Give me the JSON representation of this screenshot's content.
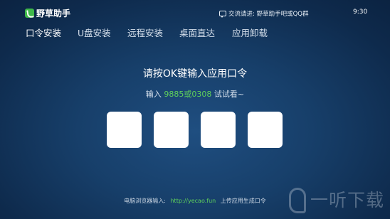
{
  "app": {
    "name": "野草助手"
  },
  "header": {
    "contact_text": "交流请进: 野草助手吧或QQ群",
    "contact_icon": "chat-bubble-icon",
    "qq_icon": "qq-penguin-icon",
    "time": "9:30"
  },
  "tabs": [
    {
      "label": "口令安装",
      "active": true
    },
    {
      "label": "U盘安装",
      "active": false
    },
    {
      "label": "远程安装",
      "active": false
    },
    {
      "label": "桌面直达",
      "active": false
    },
    {
      "label": "应用卸载",
      "active": false
    }
  ],
  "main": {
    "heading": "请按OK键输入应用口令",
    "hint_prefix": "输入",
    "hint_code": "9885或0308",
    "hint_suffix": "试试看~",
    "code_boxes": [
      "",
      "",
      "",
      ""
    ]
  },
  "footer": {
    "prefix": "电脑浏览器输入:",
    "url": "http://yecao.fun",
    "suffix": "上传应用生成口令"
  },
  "watermark": {
    "text": "一听下载"
  },
  "colors": {
    "accent_green": "#5fd15b",
    "logo_green": "#3fb84a",
    "background": "#173f6a"
  }
}
